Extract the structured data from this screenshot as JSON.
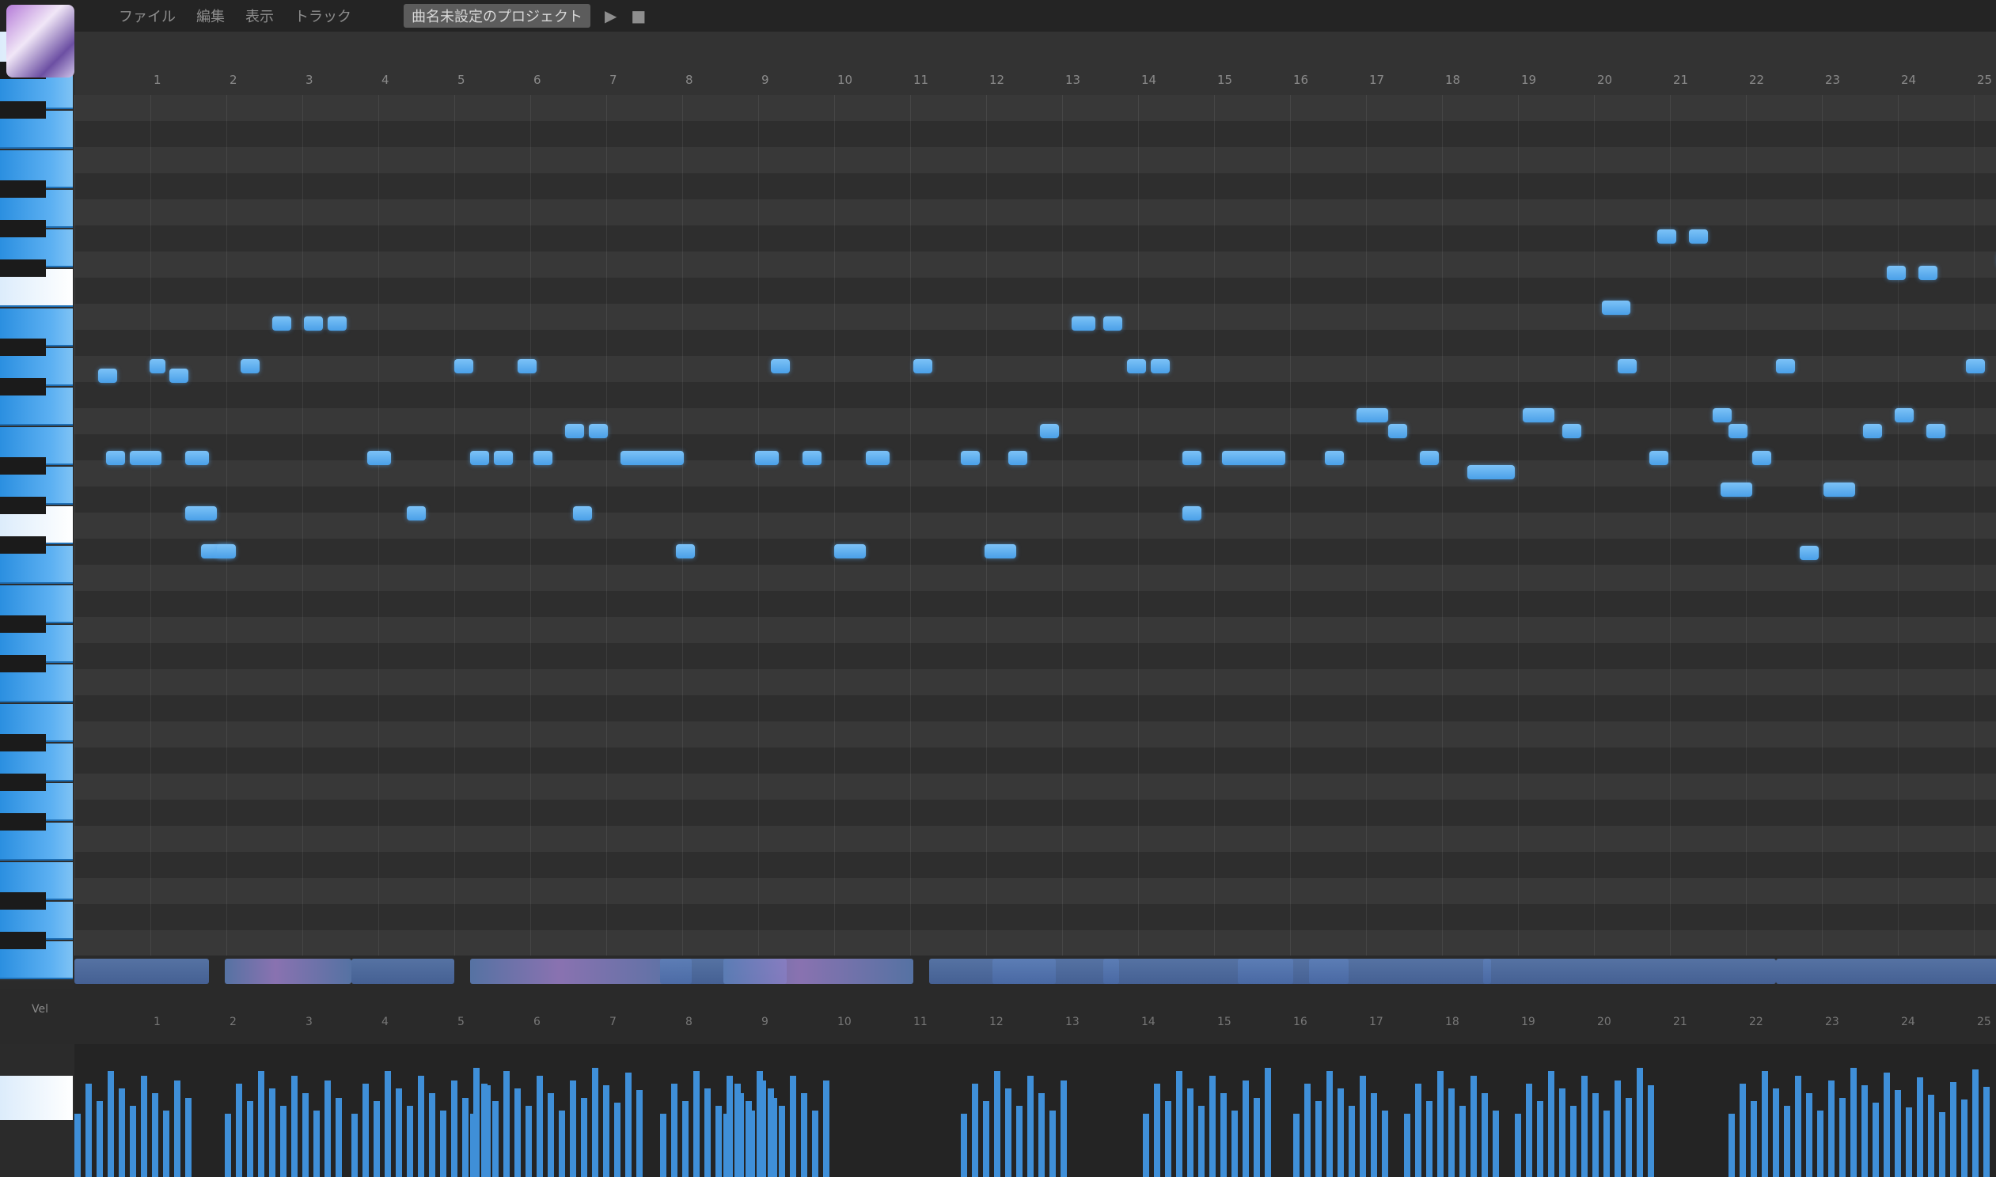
{
  "toolbar": {
    "menus": [
      "ファイル",
      "編集",
      "表示",
      "トラック"
    ],
    "song_title": "曲名未設定のプロジェクト",
    "icons": [
      "play-icon",
      "stop-icon"
    ]
  },
  "ruler": {
    "measures": [
      "1",
      "2",
      "3",
      "4",
      "5",
      "6",
      "7",
      "8",
      "9",
      "10",
      "11",
      "12",
      "13",
      "14",
      "15",
      "16",
      "17",
      "18",
      "19",
      "20",
      "21",
      "22",
      "23",
      "24",
      "25"
    ]
  },
  "lower_ruler": {
    "label": "Vel"
  },
  "colors": {
    "note": "#5aaef0",
    "piano_key": "#3a9ae8",
    "background": "#2b2b2b"
  }
}
